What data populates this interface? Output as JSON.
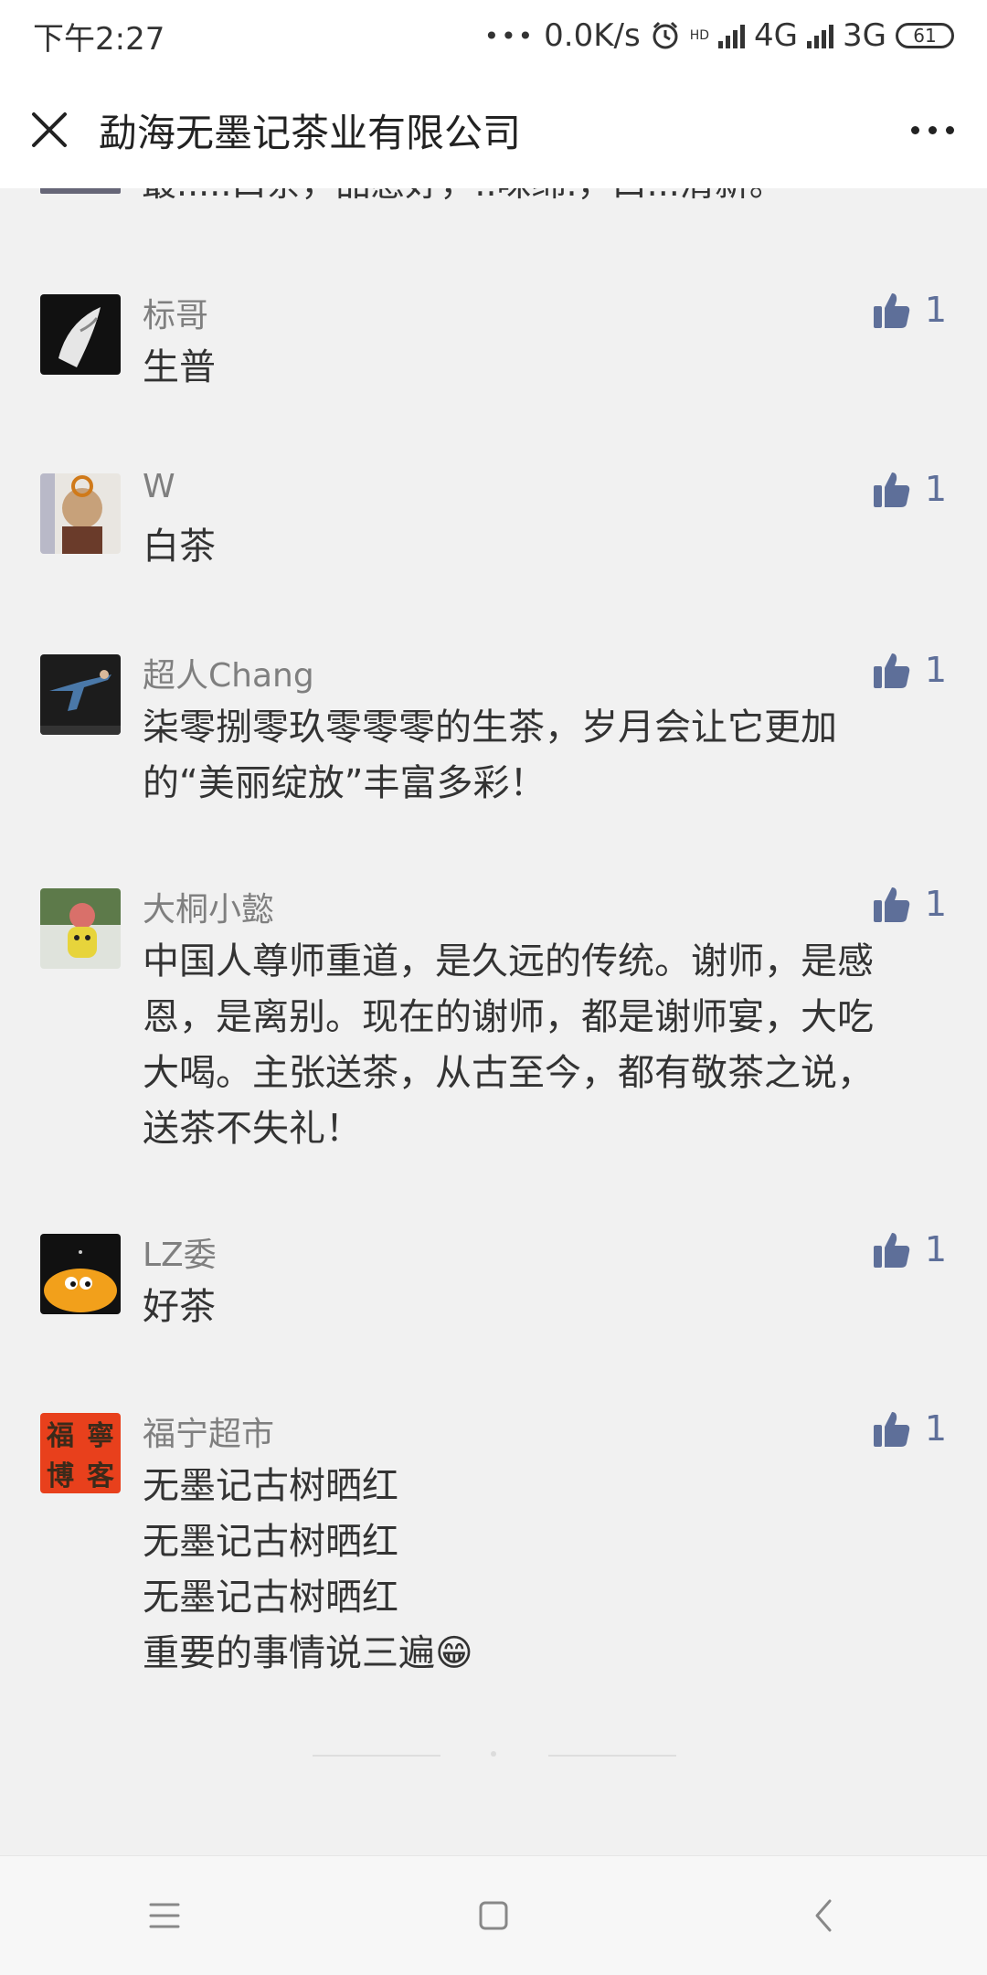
{
  "status_bar": {
    "time": "下午2:27",
    "network_speed": "0.0K/s",
    "net_4g": "4G",
    "net_3g": "3G",
    "battery": "61",
    "hd_badge": "HD"
  },
  "header": {
    "title": "勐海无墨记茶业有限公司",
    "close_icon": "close-icon",
    "more_icon": "more-icon"
  },
  "partial_comment_text": "最.....口茶，品感好，..味绵.，口...清新。",
  "comments": [
    {
      "name": "标哥",
      "lines": [
        "生普"
      ],
      "likes": "1",
      "avatar_colors": [
        "#111111",
        "#dddddd"
      ]
    },
    {
      "name": "W",
      "lines": [
        "白茶"
      ],
      "likes": "1",
      "avatar_colors": [
        "#c7a17a",
        "#6a3b2a"
      ]
    },
    {
      "name": "超人Chang",
      "lines": [
        "柒零捌零玖零零零的生茶，岁月会让它更加",
        "的“美丽绽放”丰富多彩！"
      ],
      "likes": "1",
      "avatar_colors": [
        "#1c1c1c",
        "#4a78a8"
      ]
    },
    {
      "name": "大桐小懿",
      "lines": [
        "中国人尊师重道，是久远的传统。谢师，是感",
        "恩，是离别。现在的谢师，都是谢师宴，大吃",
        "大喝。主张送茶，从古至今，都有敬茶之说，",
        "送茶不失礼！"
      ],
      "likes": "1",
      "avatar_colors": [
        "#5d7a4a",
        "#e7d43b"
      ]
    },
    {
      "name": "LZ委",
      "lines": [
        "好茶"
      ],
      "likes": "1",
      "avatar_colors": [
        "#111111",
        "#f2a01b"
      ]
    },
    {
      "name": "福宁超市",
      "lines": [
        "无墨记古树晒红",
        "无墨记古树晒红",
        "无墨记古树晒红",
        "重要的事情说三遍😁"
      ],
      "likes": "1",
      "avatar_colors": [
        "#e8401c",
        "#3b2a1a"
      ],
      "avatar_text": [
        "福",
        "寧",
        "博",
        "客"
      ]
    }
  ],
  "colors": {
    "like_blue": "#5e6f99",
    "nickname_gray": "#7f7f7f",
    "background": "#f1f1f1"
  },
  "nav": {
    "menu_icon": "menu-icon",
    "home_icon": "home-square-icon",
    "back_icon": "back-chevron-icon"
  }
}
